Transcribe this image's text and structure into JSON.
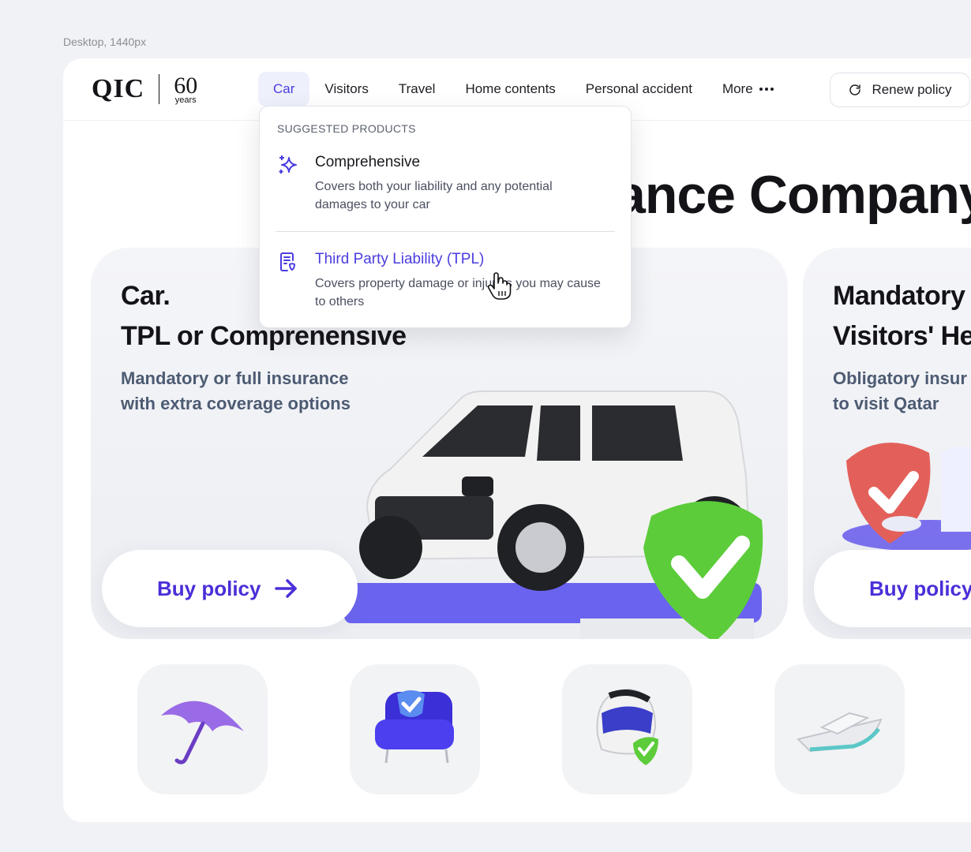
{
  "canvas_label": "Desktop, 1440px",
  "logo": {
    "brand": "QIC",
    "anniversary_number": "60",
    "anniversary_word": "years"
  },
  "nav": {
    "items": [
      {
        "label": "Car",
        "active": true
      },
      {
        "label": "Visitors"
      },
      {
        "label": "Travel"
      },
      {
        "label": "Home contents"
      },
      {
        "label": "Personal accident"
      },
      {
        "label": "More"
      }
    ],
    "renew_label": "Renew policy"
  },
  "hero": {
    "title_visible": "ance Company"
  },
  "dropdown": {
    "heading": "SUGGESTED PRODUCTS",
    "items": [
      {
        "title": "Comprehensive",
        "description": "Covers both your liability and any potential damages to your car",
        "icon": "sparkle-icon"
      },
      {
        "title": "Third Party Liability (TPL)",
        "description": "Covers property damage or injuries you may cause to others",
        "icon": "document-shield-icon"
      }
    ]
  },
  "cards": [
    {
      "title_line1": "Car.",
      "title_line2": "TPL or Comprenensive",
      "sub_line1": "Mandatory or full insurance",
      "sub_line2": "with extra coverage options",
      "button": "Buy policy"
    },
    {
      "title_line1": "Mandatory",
      "title_line2": "Visitors' He",
      "sub_line1": "Obligatory insur",
      "sub_line2": "to visit Qatar",
      "button": "Buy policy"
    }
  ],
  "tiles": [
    "umbrella-icon",
    "armchair-icon",
    "helmet-icon",
    "yacht-icon"
  ],
  "colors": {
    "accent": "#4a3de0",
    "button_text": "#4a2fd8",
    "shield_green": "#5ccc3a",
    "shield_red": "#e3605a",
    "platform": "#6a63f0"
  }
}
